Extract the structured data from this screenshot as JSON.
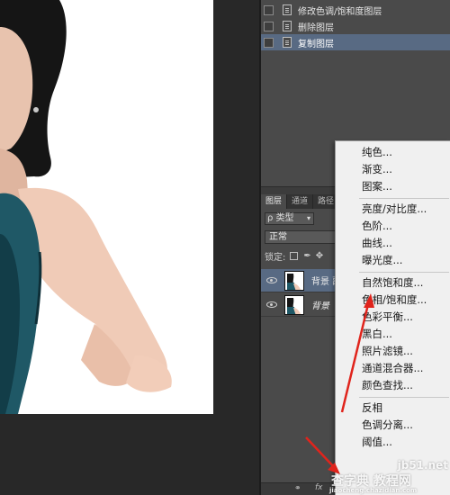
{
  "history": {
    "items": [
      {
        "label": "修改色调/饱和度图层",
        "selected": false
      },
      {
        "label": "删除图层",
        "selected": false
      },
      {
        "label": "复制图层",
        "selected": true
      }
    ]
  },
  "layers_panel": {
    "tabs": [
      "图层",
      "通道",
      "路径"
    ],
    "filter_label": "ρ 类型",
    "blend_mode": "正常",
    "lock_label": "锁定:",
    "layers": [
      {
        "name": "背景 副",
        "selected": true
      },
      {
        "name": "背景",
        "selected": false
      }
    ],
    "footer": {
      "link_icon": "link-icon",
      "fx": "fx"
    }
  },
  "menu": {
    "groups": [
      [
        "纯色...",
        "渐变...",
        "图案..."
      ],
      [
        "亮度/对比度...",
        "色阶...",
        "曲线...",
        "曝光度..."
      ],
      [
        "自然饱和度...",
        "色相/饱和度...",
        "色彩平衡...",
        "黑白...",
        "照片滤镜...",
        "通道混合器...",
        "颜色查找..."
      ],
      [
        "反相",
        "色调分离...",
        "阈值..."
      ]
    ]
  },
  "watermark": {
    "line1": "jb51.net",
    "line2": "查字典 教程网",
    "line3": "jiaocheng.chazidian.com"
  },
  "colors": {
    "accent_selected": "#586a83",
    "arrow": "#e0241c",
    "panel": "#4a4a4a"
  }
}
